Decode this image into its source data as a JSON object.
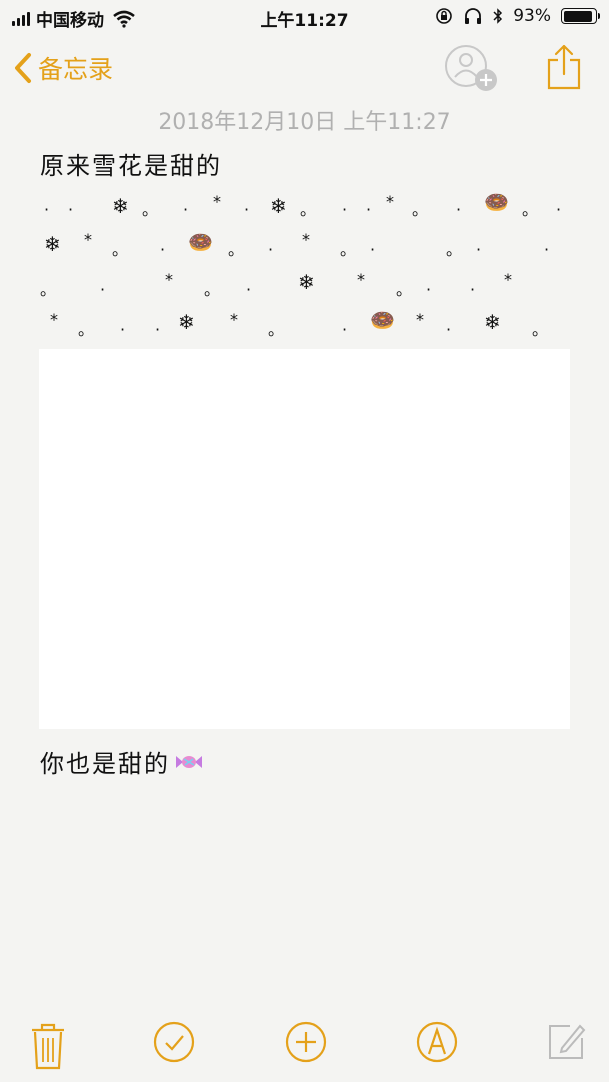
{
  "status": {
    "carrier": "中国移动",
    "time": "上午11:27",
    "battery": "93%",
    "battery_level": 0.93
  },
  "nav": {
    "back_label": "备忘录"
  },
  "note": {
    "date": "2018年12月10日 上午11:27",
    "title": "原来雪花是甜的",
    "line2": "你也是甜的"
  },
  "pattern": {
    "dot": "·",
    "ring": "。",
    "star": "*",
    "flake": "❄",
    "donut": "🍩"
  },
  "colors": {
    "accent": "#e4a11a",
    "muted": "#b0b0b0",
    "background": "#f4f4f2"
  },
  "icons": [
    "trash-icon",
    "checklist-icon",
    "add-icon",
    "markup-icon",
    "compose-icon",
    "share-icon",
    "add-person-icon",
    "candy-icon"
  ]
}
